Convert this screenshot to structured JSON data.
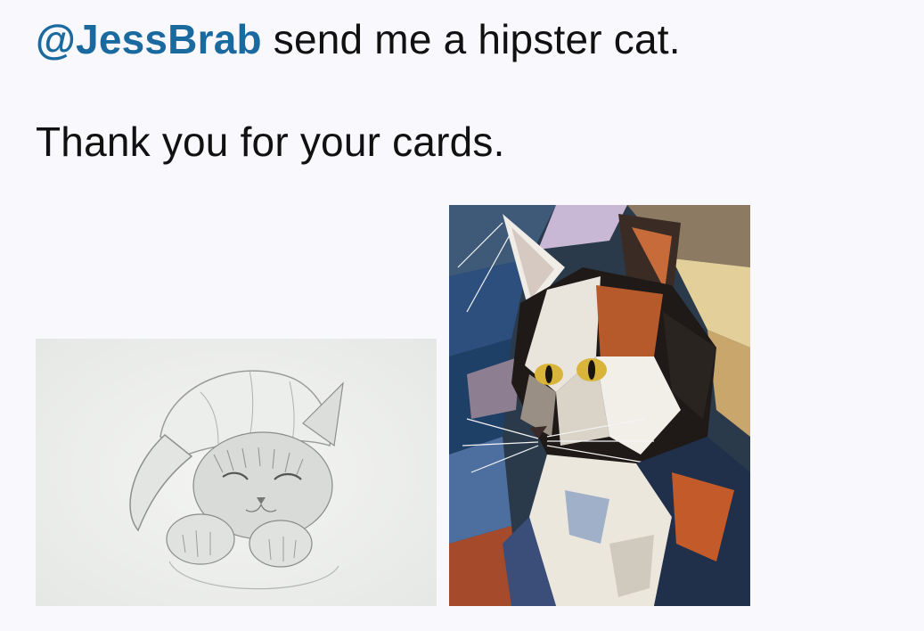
{
  "post": {
    "mention": "@JessBrab",
    "line1_rest": " send me a hipster cat.",
    "line2": "Thank you for your cards."
  },
  "images": [
    {
      "name": "pencil-sketch-kitten-in-cap",
      "alt": "Pencil sketch of a kitten wearing a baseball cap"
    },
    {
      "name": "mosaic-calico-cat",
      "alt": "Colorful stained-glass style painting of a calico cat"
    }
  ],
  "colors": {
    "background": "#f9f9fd",
    "mention": "#1a6aa0",
    "text": "#111111"
  }
}
